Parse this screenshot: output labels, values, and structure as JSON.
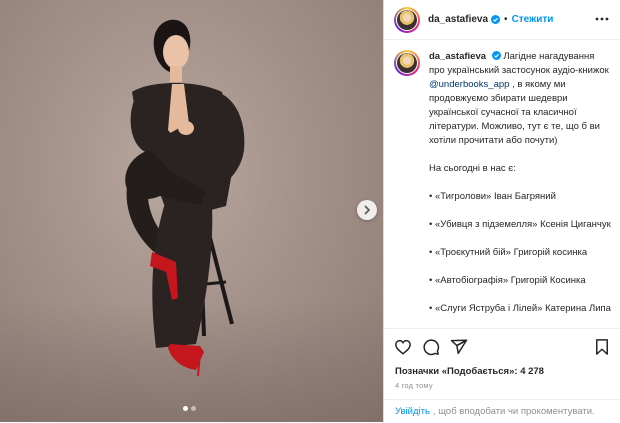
{
  "post": {
    "username": "da_astafieva",
    "follow_label": "Стежити",
    "separator": "•"
  },
  "caption": {
    "username": "da_astafieva",
    "intro_before": "Лагідне нагадування про український застосунок аудіо-книжок ",
    "mention": "@underbooks_app",
    "intro_after": " , в якому ми продовжуємо збирати шедеври української сучасної та класичної літератури. Можливо, тут є те, що б ви хотіли прочитати або почути)",
    "today_heading": "На сьогодні в нас є:",
    "books": [
      "• «Тигролови» Іван Багряний",
      "• «Убивця з підземелля» Ксенія Циганчук",
      "• «Троєкутний бій» Григорій косинка",
      "• «Автобіографія» Григорій Косинка",
      "• «Слуги Яструба і Лілей» Катерина Липа"
    ]
  },
  "stats": {
    "likes_text": "Позначки «Подобається»: 4 278",
    "time_text": "4 год тому"
  },
  "login": {
    "link_label": "Увійдіть",
    "rest_text": ", щоб вподобати чи прокоментувати."
  },
  "carousel": {
    "slide_count": 2,
    "active_index": 0
  },
  "icons": {
    "verified": "verified-badge-icon",
    "more": "more-options-icon",
    "like": "heart-icon",
    "comment": "comment-icon",
    "share": "share-icon",
    "save": "bookmark-icon",
    "next": "chevron-right-icon"
  },
  "colors": {
    "link_blue": "#0095f6",
    "mention_blue": "#00376b",
    "muted": "#8e8e8e",
    "text": "#262626",
    "suit": "#2a2322",
    "shoes": "#c4161c"
  }
}
